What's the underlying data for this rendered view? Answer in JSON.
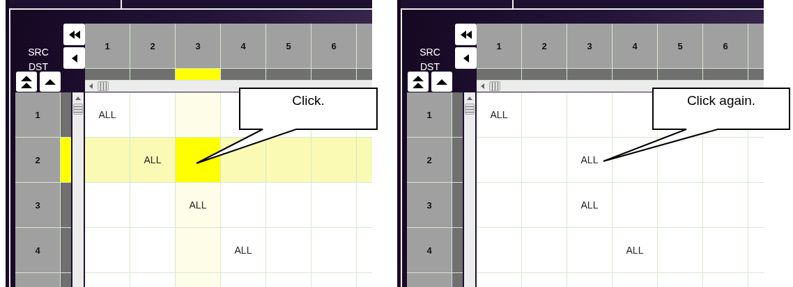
{
  "panels": [
    {
      "corner_labels": [
        "SRC",
        "DST"
      ],
      "callout": "Click.",
      "columns": [
        {
          "label": "1",
          "selected": false
        },
        {
          "label": "2",
          "selected": false
        },
        {
          "label": "3",
          "selected": true
        },
        {
          "label": "4",
          "selected": false
        },
        {
          "label": "5",
          "selected": false
        },
        {
          "label": "6",
          "selected": false
        }
      ],
      "rows": [
        {
          "label": "1",
          "selected": false,
          "cells": [
            {
              "text": "ALL",
              "selected": false
            },
            {
              "selected": false
            },
            {
              "selected": false
            },
            {
              "selected": false
            },
            {
              "selected": false
            },
            {
              "selected": false
            }
          ]
        },
        {
          "label": "2",
          "selected": true,
          "cells": [
            {
              "selected": false
            },
            {
              "text": "ALL",
              "selected": false
            },
            {
              "selected": true
            },
            {
              "selected": false
            },
            {
              "selected": false
            },
            {
              "selected": false
            }
          ]
        },
        {
          "label": "3",
          "selected": false,
          "cells": [
            {
              "selected": false
            },
            {
              "selected": false
            },
            {
              "text": "ALL",
              "selected": false
            },
            {
              "selected": false
            },
            {
              "selected": false
            },
            {
              "selected": false
            }
          ]
        },
        {
          "label": "4",
          "selected": false,
          "cells": [
            {
              "selected": false
            },
            {
              "selected": false
            },
            {
              "selected": false
            },
            {
              "text": "ALL",
              "selected": false
            },
            {
              "selected": false
            },
            {
              "selected": false
            }
          ]
        }
      ]
    },
    {
      "corner_labels": [
        "SRC",
        "DST"
      ],
      "callout": "Click again.",
      "columns": [
        {
          "label": "1",
          "selected": false
        },
        {
          "label": "2",
          "selected": false
        },
        {
          "label": "3",
          "selected": false
        },
        {
          "label": "4",
          "selected": false
        },
        {
          "label": "5",
          "selected": false
        },
        {
          "label": "6",
          "selected": false
        }
      ],
      "rows": [
        {
          "label": "1",
          "selected": false,
          "cells": [
            {
              "text": "ALL",
              "selected": false
            },
            {
              "selected": false
            },
            {
              "selected": false
            },
            {
              "selected": false
            },
            {
              "selected": false
            },
            {
              "selected": false
            }
          ]
        },
        {
          "label": "2",
          "selected": false,
          "cells": [
            {
              "selected": false
            },
            {
              "selected": false
            },
            {
              "text": "ALL",
              "selected": false
            },
            {
              "selected": false
            },
            {
              "selected": false
            },
            {
              "selected": false
            }
          ]
        },
        {
          "label": "3",
          "selected": false,
          "cells": [
            {
              "selected": false
            },
            {
              "selected": false
            },
            {
              "text": "ALL",
              "selected": false
            },
            {
              "selected": false
            },
            {
              "selected": false
            },
            {
              "selected": false
            }
          ]
        },
        {
          "label": "4",
          "selected": false,
          "cells": [
            {
              "selected": false
            },
            {
              "selected": false
            },
            {
              "selected": false
            },
            {
              "text": "ALL",
              "selected": false
            },
            {
              "selected": false
            },
            {
              "selected": false
            }
          ]
        }
      ]
    }
  ]
}
